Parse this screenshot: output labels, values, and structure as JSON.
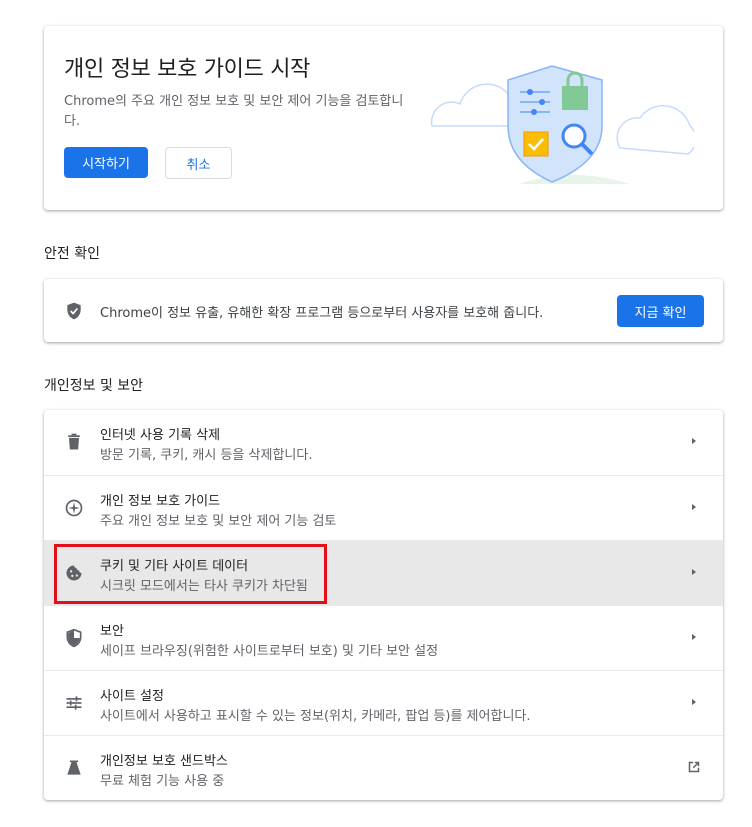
{
  "guide_promo": {
    "title": "개인 정보 보호 가이드 시작",
    "description": "Chrome의 주요 개인 정보 보호 및 보안 제어 기능을 검토합니다.",
    "start_label": "시작하기",
    "cancel_label": "취소"
  },
  "safety_check": {
    "section_title": "안전 확인",
    "description": "Chrome이 정보 유출, 유해한 확장 프로그램 등으로부터 사용자를 보호해 줍니다.",
    "button_label": "지금 확인"
  },
  "privacy_security": {
    "section_title": "개인정보 및 보안",
    "items": [
      {
        "title": "인터넷 사용 기록 삭제",
        "subtitle": "방문 기록, 쿠키, 캐시 등을 삭제합니다.",
        "icon": "trash-icon"
      },
      {
        "title": "개인 정보 보호 가이드",
        "subtitle": "주요 개인 정보 보호 및 보안 제어 기능 검토",
        "icon": "compass-icon"
      },
      {
        "title": "쿠키 및 기타 사이트 데이터",
        "subtitle": "시크릿 모드에서는 타사 쿠키가 차단됨",
        "icon": "cookie-icon"
      },
      {
        "title": "보안",
        "subtitle": "세이프 브라우징(위험한 사이트로부터 보호) 및 기타 보안 설정",
        "icon": "shield-icon"
      },
      {
        "title": "사이트 설정",
        "subtitle": "사이트에서 사용하고 표시할 수 있는 정보(위치, 카메라, 팝업 등)를 제어합니다.",
        "icon": "tune-icon"
      },
      {
        "title": "개인정보 보호 샌드박스",
        "subtitle": "무료 체험 기능 사용 중",
        "icon": "flask-icon"
      }
    ]
  },
  "colors": {
    "accent": "#1a73e8",
    "highlight_row": "#e8e8e8",
    "annotation_box": "#e1101a"
  }
}
